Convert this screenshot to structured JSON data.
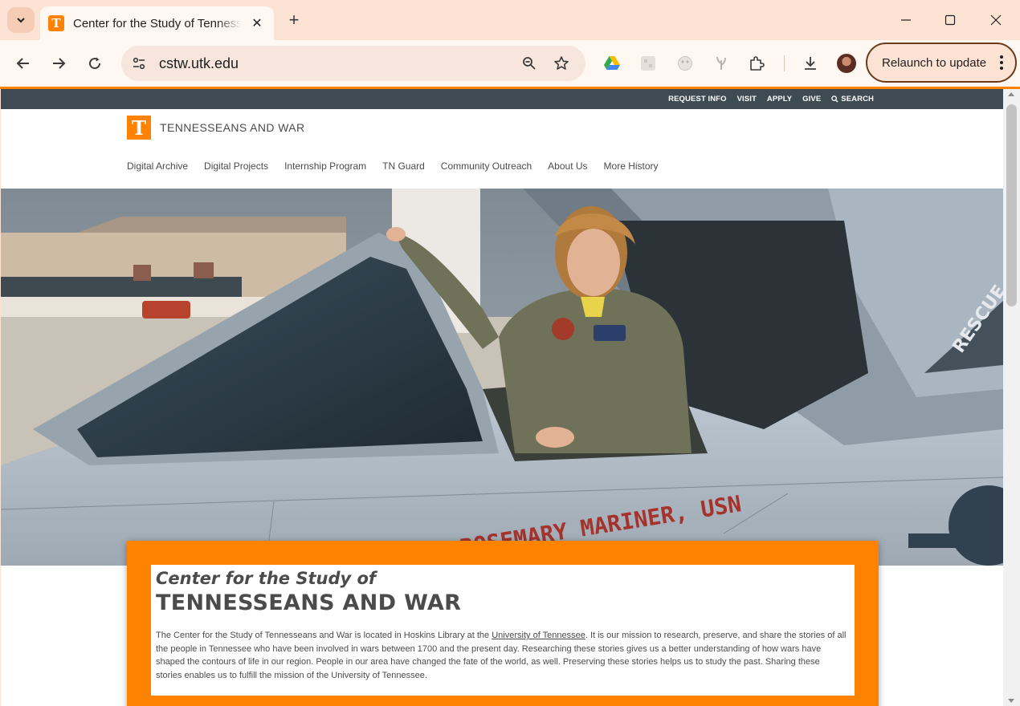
{
  "browser": {
    "tab_title": "Center for the Study of Tennessee",
    "tab_favicon": "T",
    "url": "cstw.utk.edu",
    "relaunch_label": "Relaunch to update",
    "accent_color": "#ff8200"
  },
  "site": {
    "utility_links": [
      "REQUEST INFO",
      "VISIT",
      "APPLY",
      "GIVE"
    ],
    "search_label": "SEARCH",
    "logo_letter": "T",
    "brand_name": "TENNESSEANS AND WAR",
    "nav": [
      "Digital Archive",
      "Digital Projects",
      "Internship Program",
      "TN Guard",
      "Community Outreach",
      "About Us",
      "More History"
    ],
    "hero_painted_text": "CDR ROSEMARY MARINER, USN",
    "hero_panel_text": "RESCUE",
    "card": {
      "kicker": "Center for the Study of",
      "headline": "TENNESSEANS AND WAR",
      "body_part1": "The Center for the Study of Tennesseans and War is located in Hoskins Library at the ",
      "body_link": "University of Tennessee",
      "body_part2": ".  It is our mission to research, preserve, and share the stories of all the people in Tennessee who have been involved in wars between 1700 and the present day.  Researching these stories gives us a better understanding of how wars have shaped the contours of life in our region.  People in our area have changed the fate of the world, as well.  Preserving these stories helps us to study the past.  Sharing these stories enables us to fulfill the mission of the University of Tennessee."
    }
  }
}
